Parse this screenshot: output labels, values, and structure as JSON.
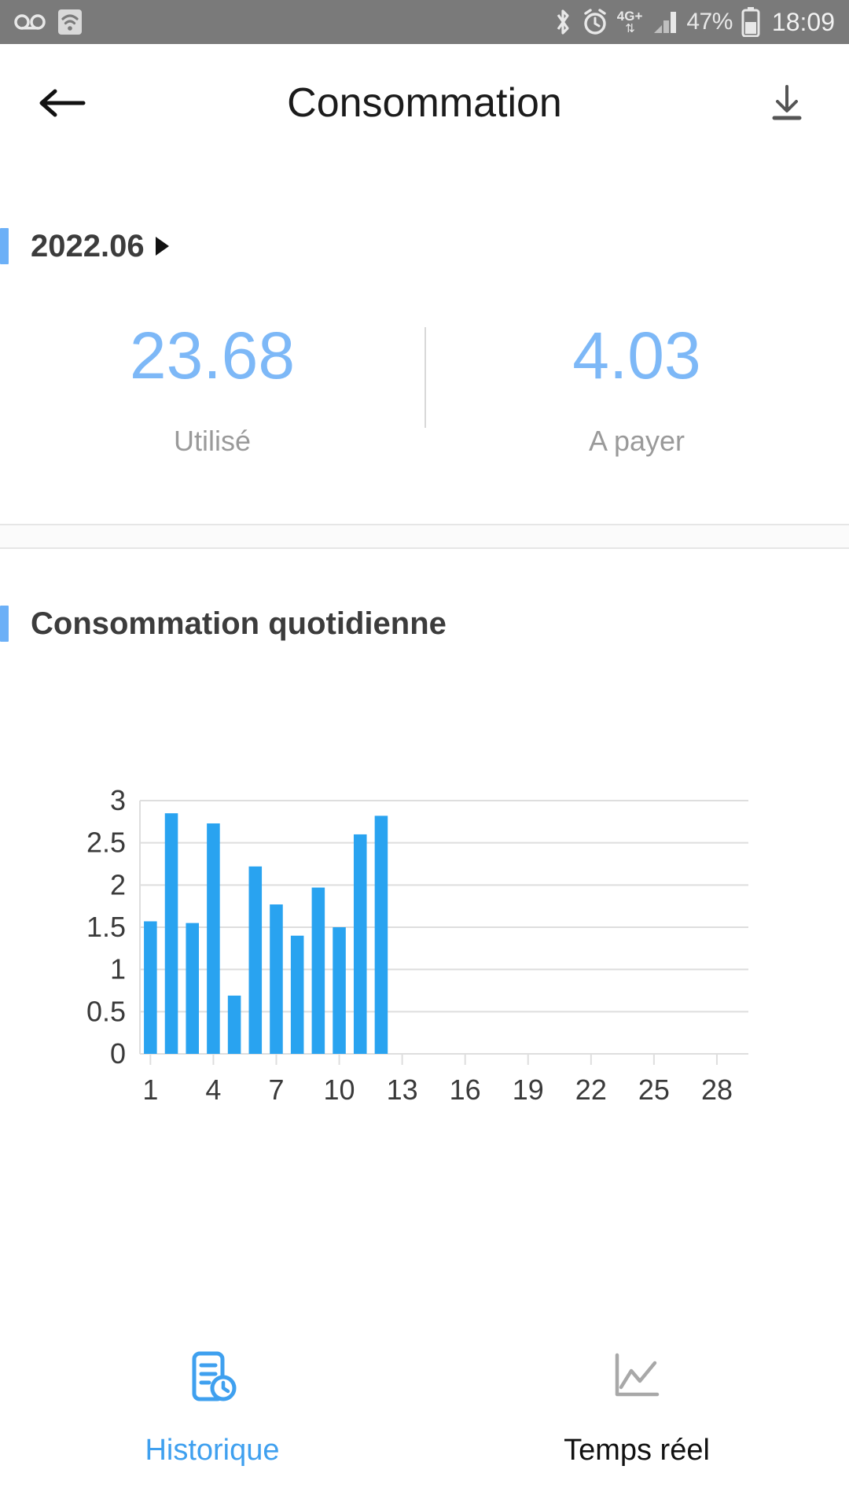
{
  "status_bar": {
    "icons_left": [
      "voicemail-icon",
      "wifi-icon"
    ],
    "icons_right": [
      "bluetooth-icon",
      "alarm-icon",
      "network-4gplus-icon",
      "signal-icon"
    ],
    "network_label": "4G",
    "network_plus": "+",
    "battery_percent": "47%",
    "time": "18:09",
    "background": "#7a7a7a"
  },
  "app_bar": {
    "title": "Consommation",
    "back_icon": "arrow-left-icon",
    "download_icon": "download-icon"
  },
  "period": {
    "label": "2022.06",
    "chevron_icon": "triangle-right-icon",
    "accent_color": "#6cb0f7"
  },
  "summary": {
    "items": [
      {
        "value": "23.68",
        "label": "Utilisé"
      },
      {
        "value": "4.03",
        "label": "A payer"
      }
    ],
    "value_color": "#7db8f7"
  },
  "daily_section": {
    "title": "Consommation quotidienne"
  },
  "chart_data": {
    "type": "bar",
    "title": "Consommation quotidienne",
    "xlabel": "",
    "ylabel": "",
    "categories": [
      1,
      2,
      3,
      4,
      5,
      6,
      7,
      8,
      9,
      10,
      11,
      12
    ],
    "values": [
      1.57,
      2.85,
      1.55,
      2.73,
      0.69,
      2.22,
      1.77,
      1.4,
      1.97,
      1.5,
      2.6,
      2.82
    ],
    "ylim": [
      0,
      3
    ],
    "yticks": [
      "0",
      "0.5",
      "1",
      "1.5",
      "2",
      "2.5",
      "3"
    ],
    "ytick_values": [
      0,
      0.5,
      1,
      1.5,
      2,
      2.5,
      3
    ],
    "xlim": [
      0.5,
      29.5
    ],
    "xticks": [
      "1",
      "4",
      "7",
      "10",
      "13",
      "16",
      "19",
      "22",
      "25",
      "28"
    ],
    "xtick_values": [
      1,
      4,
      7,
      10,
      13,
      16,
      19,
      22,
      25,
      28
    ],
    "bar_color": "#29a3f0",
    "grid": "horizontal",
    "legend": "none"
  },
  "bottom_nav": {
    "items": [
      {
        "label": "Historique",
        "icon": "history-document-clock-icon",
        "active": true
      },
      {
        "label": "Temps réel",
        "icon": "line-chart-icon",
        "active": false
      }
    ],
    "active_color": "#3fa0ef",
    "inactive_color": "#111111"
  }
}
